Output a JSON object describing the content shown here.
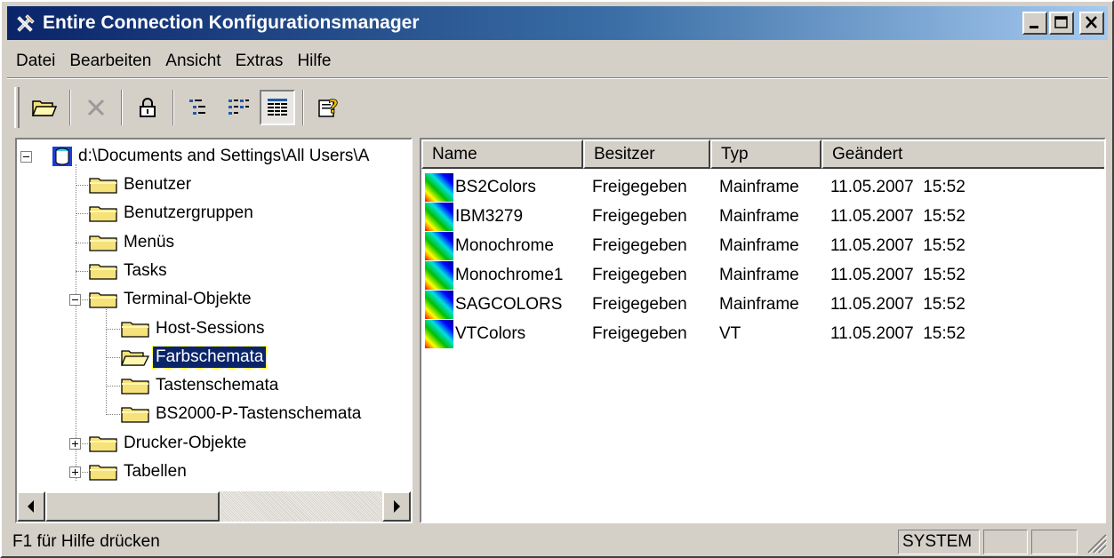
{
  "window": {
    "title": "Entire Connection Konfigurationsmanager",
    "title_icon": "tools-icon",
    "buttons": [
      "minimize",
      "maximize",
      "close"
    ]
  },
  "menu": [
    "Datei",
    "Bearbeiten",
    "Ansicht",
    "Extras",
    "Hilfe"
  ],
  "toolbar": {
    "buttons": [
      {
        "name": "open-button",
        "icon": "open-folder-icon"
      },
      {
        "name": "delete-button",
        "icon": "delete-x-icon",
        "disabled": true
      },
      {
        "name": "lock-button",
        "icon": "lock-icon"
      },
      {
        "name": "view-tree-button",
        "icon": "tree-view-icon"
      },
      {
        "name": "view-list-button",
        "icon": "list-view-icon"
      },
      {
        "name": "view-details-button",
        "icon": "details-view-icon",
        "pressed": true
      },
      {
        "name": "help-button",
        "icon": "context-help-icon"
      }
    ]
  },
  "tree": {
    "root": "d:\\Documents and Settings\\All Users\\A",
    "items": [
      {
        "label": "Benutzer",
        "level": 1
      },
      {
        "label": "Benutzergruppen",
        "level": 1
      },
      {
        "label": "Menüs",
        "level": 1
      },
      {
        "label": "Tasks",
        "level": 1
      },
      {
        "label": "Terminal-Objekte",
        "level": 1,
        "expanded": true
      },
      {
        "label": "Host-Sessions",
        "level": 2
      },
      {
        "label": "Farbschemata",
        "level": 2,
        "selected": true
      },
      {
        "label": "Tastenschemata",
        "level": 2
      },
      {
        "label": "BS2000-P-Tastenschemata",
        "level": 2
      },
      {
        "label": "Drucker-Objekte",
        "level": 1,
        "collapsed": true
      },
      {
        "label": "Tabellen",
        "level": 1,
        "collapsed": true
      }
    ]
  },
  "list": {
    "columns": [
      "Name",
      "Besitzer",
      "Typ",
      "Geändert"
    ],
    "rows": [
      {
        "name": "BS2Colors",
        "owner": "Freigegeben",
        "type": "Mainframe",
        "changed": "11.05.2007  15:52"
      },
      {
        "name": "IBM3279",
        "owner": "Freigegeben",
        "type": "Mainframe",
        "changed": "11.05.2007  15:52"
      },
      {
        "name": "Monochrome",
        "owner": "Freigegeben",
        "type": "Mainframe",
        "changed": "11.05.2007  15:52"
      },
      {
        "name": "Monochrome1",
        "owner": "Freigegeben",
        "type": "Mainframe",
        "changed": "11.05.2007  15:52"
      },
      {
        "name": "SAGCOLORS",
        "owner": "Freigegeben",
        "type": "Mainframe",
        "changed": "11.05.2007  15:52"
      },
      {
        "name": "VTColors",
        "owner": "Freigegeben",
        "type": "VT",
        "changed": "11.05.2007  15:52"
      }
    ]
  },
  "status": {
    "text": "F1 für Hilfe drücken",
    "panes": [
      "SYSTEM",
      "",
      ""
    ]
  },
  "colors": {
    "title_start": "#0a246a",
    "title_end": "#a6caf0",
    "selection": "#0a246a",
    "face": "#d4d0c8",
    "folder": "#f6e27a"
  }
}
